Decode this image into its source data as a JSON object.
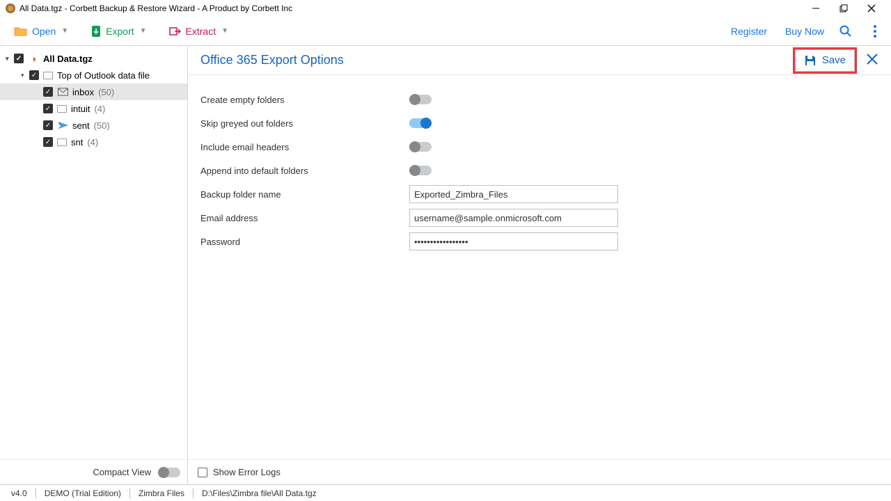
{
  "title": "All Data.tgz - Corbett Backup & Restore Wizard - A Product by Corbett Inc",
  "toolbar": {
    "open": "Open",
    "export": "Export",
    "extract": "Extract",
    "register": "Register",
    "buynow": "Buy Now"
  },
  "tree": {
    "root": "All Data.tgz",
    "l1": "Top of Outlook data file",
    "items": [
      {
        "label": "inbox",
        "count": "(50)"
      },
      {
        "label": "intuit",
        "count": "(4)"
      },
      {
        "label": "sent",
        "count": "(50)"
      },
      {
        "label": "snt",
        "count": "(4)"
      }
    ]
  },
  "compact": "Compact View",
  "main": {
    "title": "Office 365 Export Options",
    "save": "Save",
    "options": {
      "create_empty": "Create empty folders",
      "skip_greyed": "Skip greyed out folders",
      "include_headers": "Include email headers",
      "append_default": "Append into default folders",
      "backup_name_label": "Backup folder name",
      "backup_name_value": "Exported_Zimbra_Files",
      "email_label": "Email address",
      "email_value": "username@sample.onmicrosoft.com",
      "password_label": "Password",
      "password_value": "•••••••••••••••••"
    },
    "show_logs": "Show Error Logs"
  },
  "status": {
    "version": "v4.0",
    "edition": "DEMO (Trial Edition)",
    "filetype": "Zimbra Files",
    "path": "D:\\Files\\Zimbra file\\All Data.tgz"
  }
}
